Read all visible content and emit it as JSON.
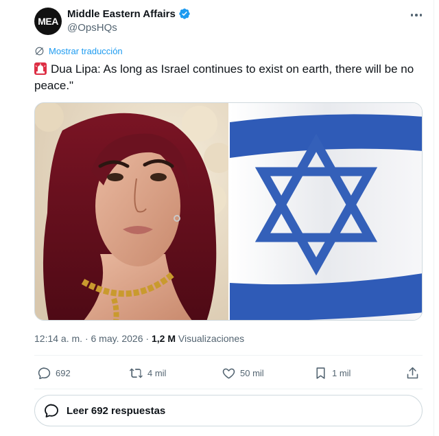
{
  "author": {
    "avatar_text": "MEA",
    "display_name": "Middle Eastern Affairs",
    "handle": "@OpsHQs",
    "verified": true
  },
  "translate_label": "Mostrar traducción",
  "tweet": {
    "emoji": "siren",
    "text": "Dua Lipa: As long as Israel continues to exist on earth, there will be no peace.\""
  },
  "media": {
    "left_image": "portrait photo of a woman with long burgundy hair and gold chain necklace",
    "right_image": "flag of Israel waving"
  },
  "meta": {
    "time": "12:14 a. m.",
    "separator": "·",
    "date": "6 may. 2026",
    "views_count": "1,2 M",
    "views_label": "Visualizaciones"
  },
  "actions": {
    "replies": "692",
    "reposts": "4 mil",
    "likes": "50 mil",
    "bookmarks": "1 mil"
  },
  "read_replies_label": "Leer 692 respuestas",
  "colors": {
    "accent": "#1d9bf0",
    "muted": "#536471",
    "text": "#0f1419",
    "flag_blue": "#2f5bb7"
  }
}
